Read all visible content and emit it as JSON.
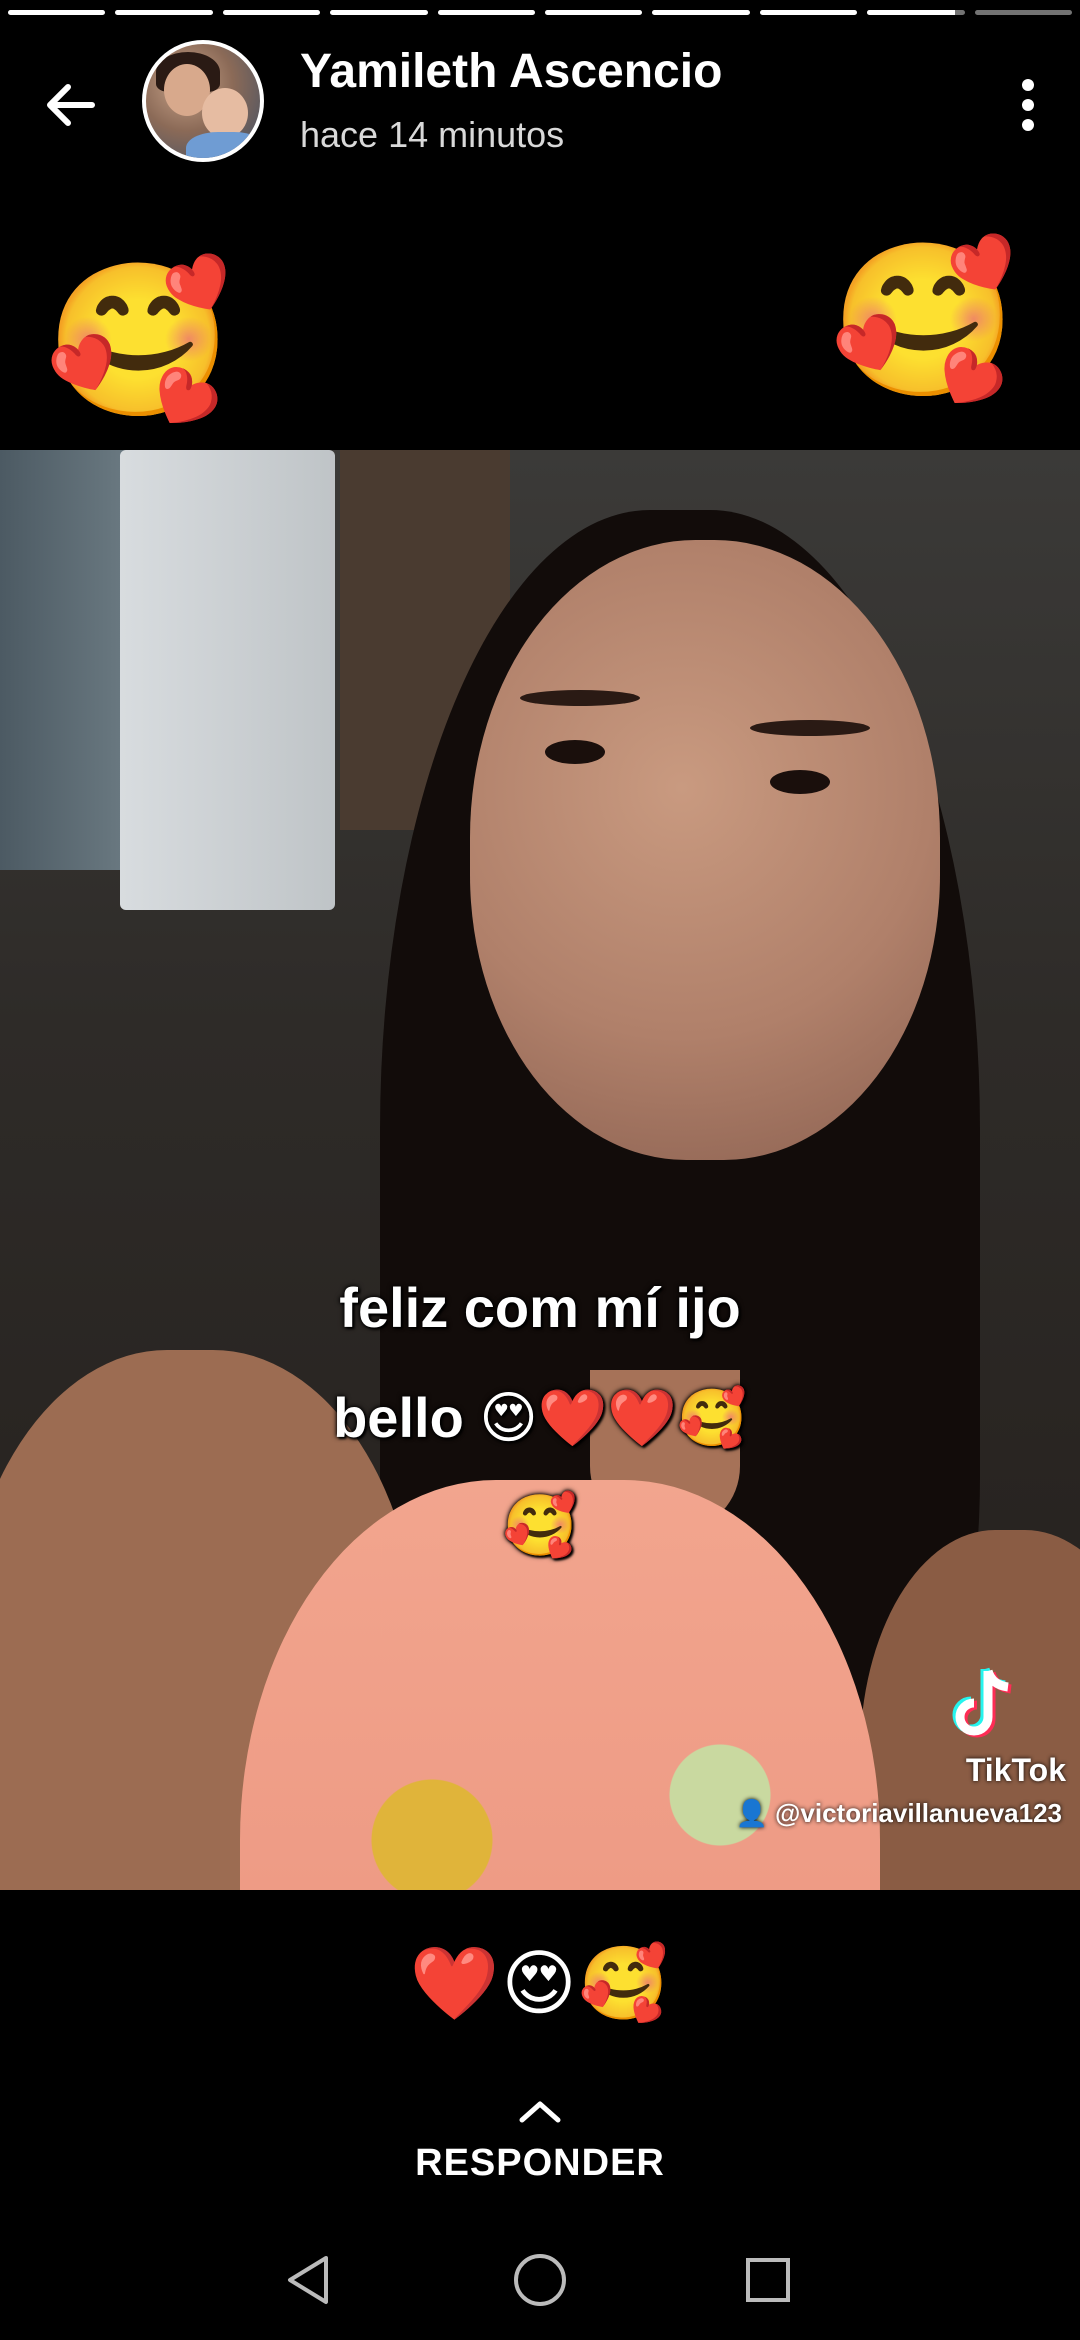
{
  "story": {
    "progress_segments": [
      1,
      1,
      1,
      1,
      1,
      1,
      1,
      1,
      0.9,
      0
    ],
    "user_name": "Yamileth Ascencio",
    "timestamp": "hace 14 minutos",
    "sticker_emoji": "🥰",
    "caption": {
      "line1": "feliz com mí ijo",
      "line2": "bello 😍❤️❤️🥰",
      "line3": "🥰"
    },
    "watermark": {
      "brand": "TikTok",
      "username": "@victoriavillanueva123"
    }
  },
  "footer": {
    "reactions": "❤️😍🥰",
    "reply_label": "RESPONDER"
  },
  "icons": {
    "back": "back-arrow-icon",
    "more": "more-vertical-icon",
    "reply": "chevron-up-icon",
    "nav_back": "triangle-back-icon",
    "nav_home": "circle-home-icon",
    "nav_recents": "square-recents-icon"
  }
}
